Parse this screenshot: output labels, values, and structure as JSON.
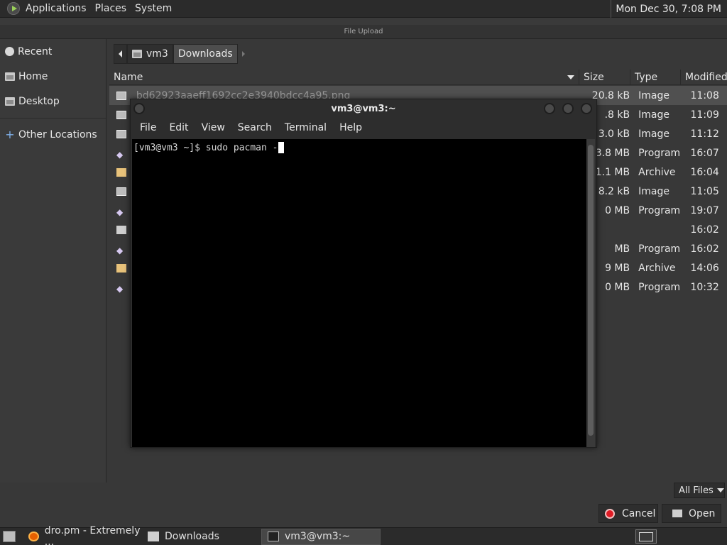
{
  "top_panel": {
    "menus": [
      "Applications",
      "Places",
      "System"
    ],
    "clock": "Mon Dec 30,  7:08 PM"
  },
  "dialog": {
    "title": "File Upload",
    "sidebar": {
      "items": [
        {
          "label": "Recent",
          "icon": "recent-icon"
        },
        {
          "label": "Home",
          "icon": "home-folder-icon"
        },
        {
          "label": "Desktop",
          "icon": "desktop-folder-icon"
        }
      ],
      "other": {
        "label": "Other Locations",
        "icon": "plus-icon"
      }
    },
    "path": [
      "vm3",
      "Downloads"
    ],
    "columns": {
      "name": "Name",
      "size": "Size",
      "type": "Type",
      "modified": "Modified"
    },
    "files": [
      {
        "name": "bd62923aaeff1692cc2e3940bdcc4a95.png",
        "size": "20.8 kB",
        "type": "Image",
        "modified": "11:08",
        "icon": "image",
        "selected": true
      },
      {
        "name": "",
        "size": ".8 kB",
        "type": "Image",
        "modified": "11:09",
        "icon": "image"
      },
      {
        "name": "",
        "size": "3.0 kB",
        "type": "Image",
        "modified": "11:12",
        "icon": "image"
      },
      {
        "name": "",
        "size": "3.8 MB",
        "type": "Program",
        "modified": "16:07",
        "icon": "program"
      },
      {
        "name": "",
        "size": "1.1 MB",
        "type": "Archive",
        "modified": "16:04",
        "icon": "archive"
      },
      {
        "name": "",
        "size": "8.2 kB",
        "type": "Image",
        "modified": "11:05",
        "icon": "image"
      },
      {
        "name": "",
        "size": "0 MB",
        "type": "Program",
        "modified": "19:07",
        "icon": "program"
      },
      {
        "name": "",
        "size": "",
        "type": "",
        "modified": "16:02",
        "icon": "folder"
      },
      {
        "name": "",
        "size": "MB",
        "type": "Program",
        "modified": "16:02",
        "icon": "program"
      },
      {
        "name": "",
        "size": "9 MB",
        "type": "Archive",
        "modified": "14:06",
        "icon": "archive"
      },
      {
        "name": "",
        "size": "0 MB",
        "type": "Program",
        "modified": "10:32",
        "icon": "program"
      }
    ],
    "filter": "All Files",
    "cancel": "Cancel",
    "open": "Open"
  },
  "terminal": {
    "title": "vm3@vm3:~",
    "menus": [
      "File",
      "Edit",
      "View",
      "Search",
      "Terminal",
      "Help"
    ],
    "prompt": "[vm3@vm3 ~]$ sudo pacman -"
  },
  "taskbar": {
    "tasks": [
      {
        "label": "dro.pm - Extremely ...",
        "icon": "firefox-icon"
      },
      {
        "label": "Downloads",
        "icon": "folder-icon"
      },
      {
        "label": "vm3@vm3:~",
        "icon": "terminal-icon",
        "active": true
      }
    ]
  }
}
